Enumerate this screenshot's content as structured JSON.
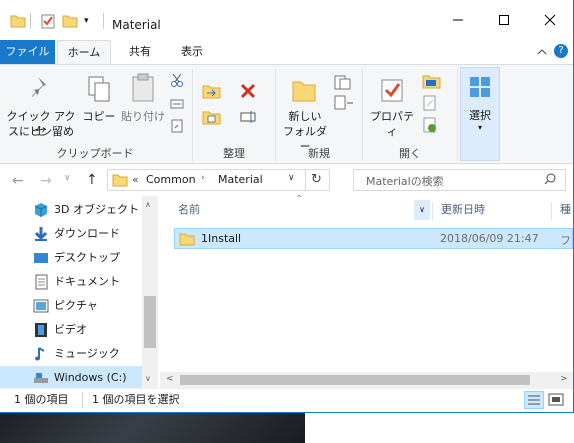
{
  "window": {
    "title": "Material"
  },
  "ribbon_tabs": {
    "file": "ファイル",
    "home": "ホーム",
    "share": "共有",
    "view": "表示"
  },
  "ribbon": {
    "pin_label_1": "クイック アクセ",
    "pin_label_2": "スにピン留め",
    "copy": "コピー",
    "paste": "貼り付け",
    "clipboard_group": "クリップボード",
    "organize_group": "整理",
    "new_folder_1": "新しい",
    "new_folder_2": "フォルダー",
    "new_group": "新規",
    "properties": "プロパティ",
    "open_group": "開く",
    "select": "選択"
  },
  "address": {
    "overflow": "«",
    "crumbs": [
      "Common",
      "Material"
    ],
    "search_placeholder": "Materialの検索"
  },
  "nav": {
    "items": [
      {
        "label": "3D オブジェクト",
        "icon": "3d-objects-icon"
      },
      {
        "label": "ダウンロード",
        "icon": "download-icon"
      },
      {
        "label": "デスクトップ",
        "icon": "desktop-icon"
      },
      {
        "label": "ドキュメント",
        "icon": "documents-icon"
      },
      {
        "label": "ピクチャ",
        "icon": "pictures-icon"
      },
      {
        "label": "ビデオ",
        "icon": "videos-icon"
      },
      {
        "label": "ミュージック",
        "icon": "music-icon"
      },
      {
        "label": "Windows (C:)",
        "icon": "drive-icon"
      }
    ]
  },
  "columns": {
    "name": "名前",
    "modified": "更新日時",
    "type": "種"
  },
  "files": [
    {
      "name": "1Install",
      "modified": "2018/06/09 21:47",
      "type": "ファ"
    }
  ],
  "status": {
    "count": "1 個の項目",
    "selected": "1 個の項目を選択"
  },
  "colors": {
    "accent": "#1979ca",
    "selection": "#cce8ff",
    "folder": "#f8d775"
  }
}
